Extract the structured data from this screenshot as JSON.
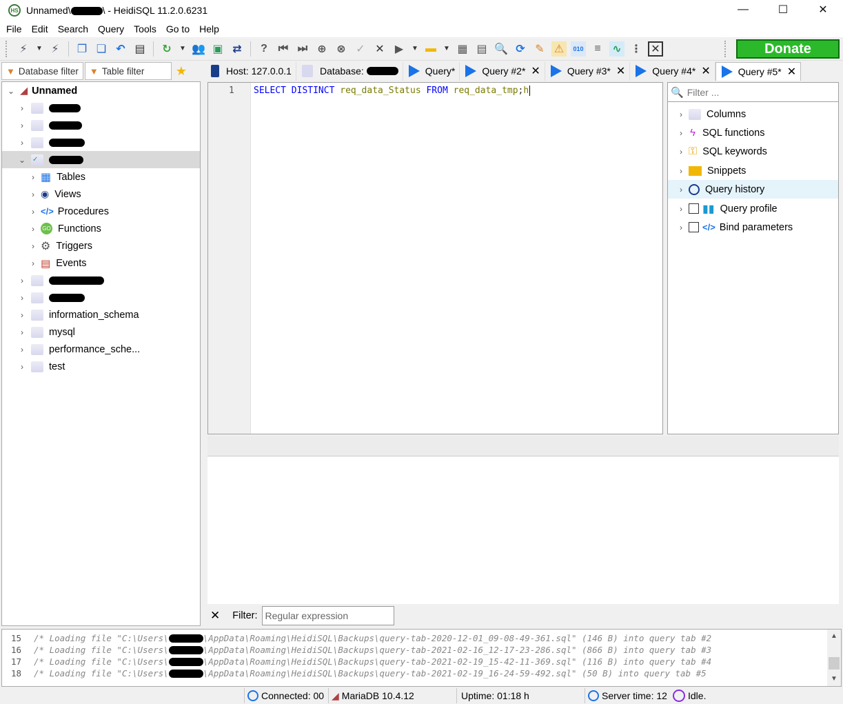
{
  "window": {
    "title_prefix": "Unnamed\\",
    "title_suffix": "\\ - HeidiSQL 11.2.0.6231",
    "min": "—",
    "max": "☐",
    "close": "✕"
  },
  "menu": [
    "File",
    "Edit",
    "Search",
    "Query",
    "Tools",
    "Go to",
    "Help"
  ],
  "toolbar": {
    "donate": "Donate"
  },
  "filters": {
    "database": "Database filter",
    "table": "Table filter"
  },
  "tabs": {
    "host": "Host: 127.0.0.1",
    "database": "Database:",
    "queries": [
      "Query*",
      "Query #2*",
      "Query #3*",
      "Query #4*",
      "Query #5*"
    ]
  },
  "tree": {
    "root": "Unnamed",
    "children": [
      "Tables",
      "Views",
      "Procedures",
      "Functions",
      "Triggers",
      "Events"
    ],
    "databases": [
      "information_schema",
      "mysql",
      "performance_sche...",
      "test"
    ]
  },
  "editor": {
    "line": "1",
    "kw1": "SELECT",
    "kw2": "DISTINCT",
    "col": "req_data_Status",
    "kw3": "FROM",
    "table": "req_data_tmp",
    "semi": ";",
    "tail": "h"
  },
  "helpers": {
    "filter_placeholder": "Filter ...",
    "items": [
      "Columns",
      "SQL functions",
      "SQL keywords",
      "Snippets",
      "Query history",
      "Query profile",
      "Bind parameters"
    ]
  },
  "result_filter": {
    "label": "Filter:",
    "placeholder": "Regular expression"
  },
  "log": [
    {
      "no": "15",
      "pre": "/* Loading file \"C:\\Users\\",
      "post": "\\AppData\\Roaming\\HeidiSQL\\Backups\\query-tab-2020-12-01_09-08-49-361.sql\" (146 B) into query tab #2"
    },
    {
      "no": "16",
      "pre": "/* Loading file \"C:\\Users\\",
      "post": "\\AppData\\Roaming\\HeidiSQL\\Backups\\query-tab-2021-02-16_12-17-23-286.sql\" (866 B) into query tab #3"
    },
    {
      "no": "17",
      "pre": "/* Loading file \"C:\\Users\\",
      "post": "\\AppData\\Roaming\\HeidiSQL\\Backups\\query-tab-2021-02-19_15-42-11-369.sql\" (116 B) into query tab #4"
    },
    {
      "no": "18",
      "pre": "/* Loading file \"C:\\Users\\",
      "post": "\\AppData\\Roaming\\HeidiSQL\\Backups\\query-tab-2021-02-19_16-24-59-492.sql\" (50 B) into query tab #5"
    }
  ],
  "status": {
    "connected": "Connected: 00",
    "server": "MariaDB 10.4.12",
    "uptime": "Uptime: 01:18 h",
    "server_time": "Server time: 12",
    "idle": "Idle."
  },
  "colors": {
    "accent": "#1a73e8",
    "donate": "#2bb92b",
    "keyword": "#0000ff",
    "identifier": "#7a7a00"
  }
}
